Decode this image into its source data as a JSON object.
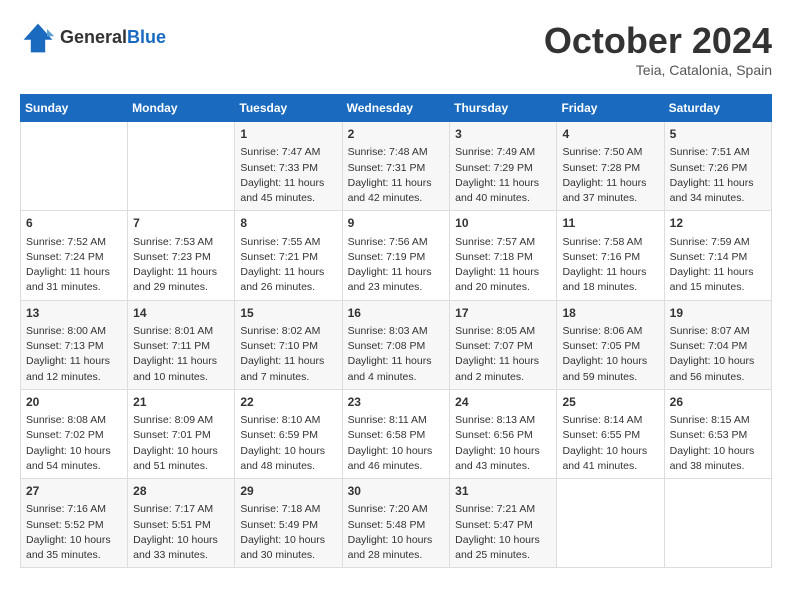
{
  "header": {
    "logo_line1": "General",
    "logo_line2": "Blue",
    "month": "October 2024",
    "location": "Teia, Catalonia, Spain"
  },
  "columns": [
    "Sunday",
    "Monday",
    "Tuesday",
    "Wednesday",
    "Thursday",
    "Friday",
    "Saturday"
  ],
  "rows": [
    [
      {
        "day": "",
        "info": ""
      },
      {
        "day": "",
        "info": ""
      },
      {
        "day": "1",
        "info": "Sunrise: 7:47 AM\nSunset: 7:33 PM\nDaylight: 11 hours and 45 minutes."
      },
      {
        "day": "2",
        "info": "Sunrise: 7:48 AM\nSunset: 7:31 PM\nDaylight: 11 hours and 42 minutes."
      },
      {
        "day": "3",
        "info": "Sunrise: 7:49 AM\nSunset: 7:29 PM\nDaylight: 11 hours and 40 minutes."
      },
      {
        "day": "4",
        "info": "Sunrise: 7:50 AM\nSunset: 7:28 PM\nDaylight: 11 hours and 37 minutes."
      },
      {
        "day": "5",
        "info": "Sunrise: 7:51 AM\nSunset: 7:26 PM\nDaylight: 11 hours and 34 minutes."
      }
    ],
    [
      {
        "day": "6",
        "info": "Sunrise: 7:52 AM\nSunset: 7:24 PM\nDaylight: 11 hours and 31 minutes."
      },
      {
        "day": "7",
        "info": "Sunrise: 7:53 AM\nSunset: 7:23 PM\nDaylight: 11 hours and 29 minutes."
      },
      {
        "day": "8",
        "info": "Sunrise: 7:55 AM\nSunset: 7:21 PM\nDaylight: 11 hours and 26 minutes."
      },
      {
        "day": "9",
        "info": "Sunrise: 7:56 AM\nSunset: 7:19 PM\nDaylight: 11 hours and 23 minutes."
      },
      {
        "day": "10",
        "info": "Sunrise: 7:57 AM\nSunset: 7:18 PM\nDaylight: 11 hours and 20 minutes."
      },
      {
        "day": "11",
        "info": "Sunrise: 7:58 AM\nSunset: 7:16 PM\nDaylight: 11 hours and 18 minutes."
      },
      {
        "day": "12",
        "info": "Sunrise: 7:59 AM\nSunset: 7:14 PM\nDaylight: 11 hours and 15 minutes."
      }
    ],
    [
      {
        "day": "13",
        "info": "Sunrise: 8:00 AM\nSunset: 7:13 PM\nDaylight: 11 hours and 12 minutes."
      },
      {
        "day": "14",
        "info": "Sunrise: 8:01 AM\nSunset: 7:11 PM\nDaylight: 11 hours and 10 minutes."
      },
      {
        "day": "15",
        "info": "Sunrise: 8:02 AM\nSunset: 7:10 PM\nDaylight: 11 hours and 7 minutes."
      },
      {
        "day": "16",
        "info": "Sunrise: 8:03 AM\nSunset: 7:08 PM\nDaylight: 11 hours and 4 minutes."
      },
      {
        "day": "17",
        "info": "Sunrise: 8:05 AM\nSunset: 7:07 PM\nDaylight: 11 hours and 2 minutes."
      },
      {
        "day": "18",
        "info": "Sunrise: 8:06 AM\nSunset: 7:05 PM\nDaylight: 10 hours and 59 minutes."
      },
      {
        "day": "19",
        "info": "Sunrise: 8:07 AM\nSunset: 7:04 PM\nDaylight: 10 hours and 56 minutes."
      }
    ],
    [
      {
        "day": "20",
        "info": "Sunrise: 8:08 AM\nSunset: 7:02 PM\nDaylight: 10 hours and 54 minutes."
      },
      {
        "day": "21",
        "info": "Sunrise: 8:09 AM\nSunset: 7:01 PM\nDaylight: 10 hours and 51 minutes."
      },
      {
        "day": "22",
        "info": "Sunrise: 8:10 AM\nSunset: 6:59 PM\nDaylight: 10 hours and 48 minutes."
      },
      {
        "day": "23",
        "info": "Sunrise: 8:11 AM\nSunset: 6:58 PM\nDaylight: 10 hours and 46 minutes."
      },
      {
        "day": "24",
        "info": "Sunrise: 8:13 AM\nSunset: 6:56 PM\nDaylight: 10 hours and 43 minutes."
      },
      {
        "day": "25",
        "info": "Sunrise: 8:14 AM\nSunset: 6:55 PM\nDaylight: 10 hours and 41 minutes."
      },
      {
        "day": "26",
        "info": "Sunrise: 8:15 AM\nSunset: 6:53 PM\nDaylight: 10 hours and 38 minutes."
      }
    ],
    [
      {
        "day": "27",
        "info": "Sunrise: 7:16 AM\nSunset: 5:52 PM\nDaylight: 10 hours and 35 minutes."
      },
      {
        "day": "28",
        "info": "Sunrise: 7:17 AM\nSunset: 5:51 PM\nDaylight: 10 hours and 33 minutes."
      },
      {
        "day": "29",
        "info": "Sunrise: 7:18 AM\nSunset: 5:49 PM\nDaylight: 10 hours and 30 minutes."
      },
      {
        "day": "30",
        "info": "Sunrise: 7:20 AM\nSunset: 5:48 PM\nDaylight: 10 hours and 28 minutes."
      },
      {
        "day": "31",
        "info": "Sunrise: 7:21 AM\nSunset: 5:47 PM\nDaylight: 10 hours and 25 minutes."
      },
      {
        "day": "",
        "info": ""
      },
      {
        "day": "",
        "info": ""
      }
    ]
  ]
}
